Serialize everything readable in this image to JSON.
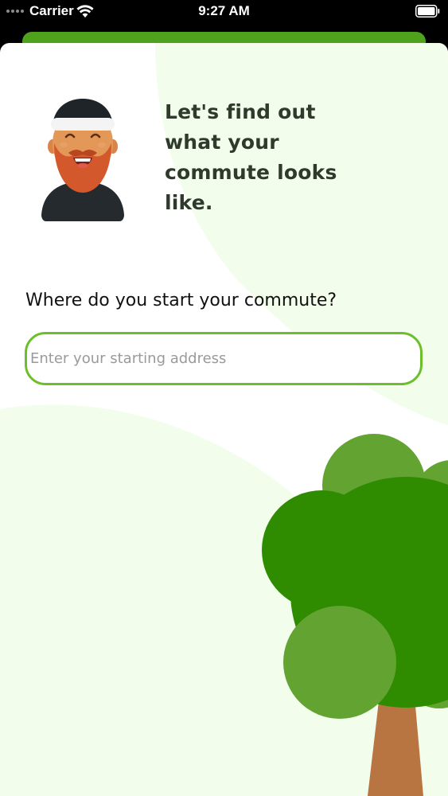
{
  "status_bar": {
    "carrier": "Carrier",
    "time": "9:27 AM"
  },
  "intro": {
    "heading": "Let's find out what your commute looks like."
  },
  "form": {
    "question": "Where do you start your commute?",
    "address_placeholder": "Enter your starting address",
    "address_value": ""
  },
  "icons": {
    "signal": "signal-dots-icon",
    "wifi": "wifi-icon",
    "battery": "battery-icon",
    "avatar": "bearded-man-avatar",
    "tree": "tree-illustration"
  },
  "colors": {
    "accent_green": "#6cbf2a",
    "back_card_green": "#4fa31c",
    "pale_green_bg": "#f2fdec",
    "tree_dark": "#2f8c00",
    "tree_light": "#62a331",
    "trunk": "#b87542",
    "heading_text": "#2e3a2b"
  }
}
